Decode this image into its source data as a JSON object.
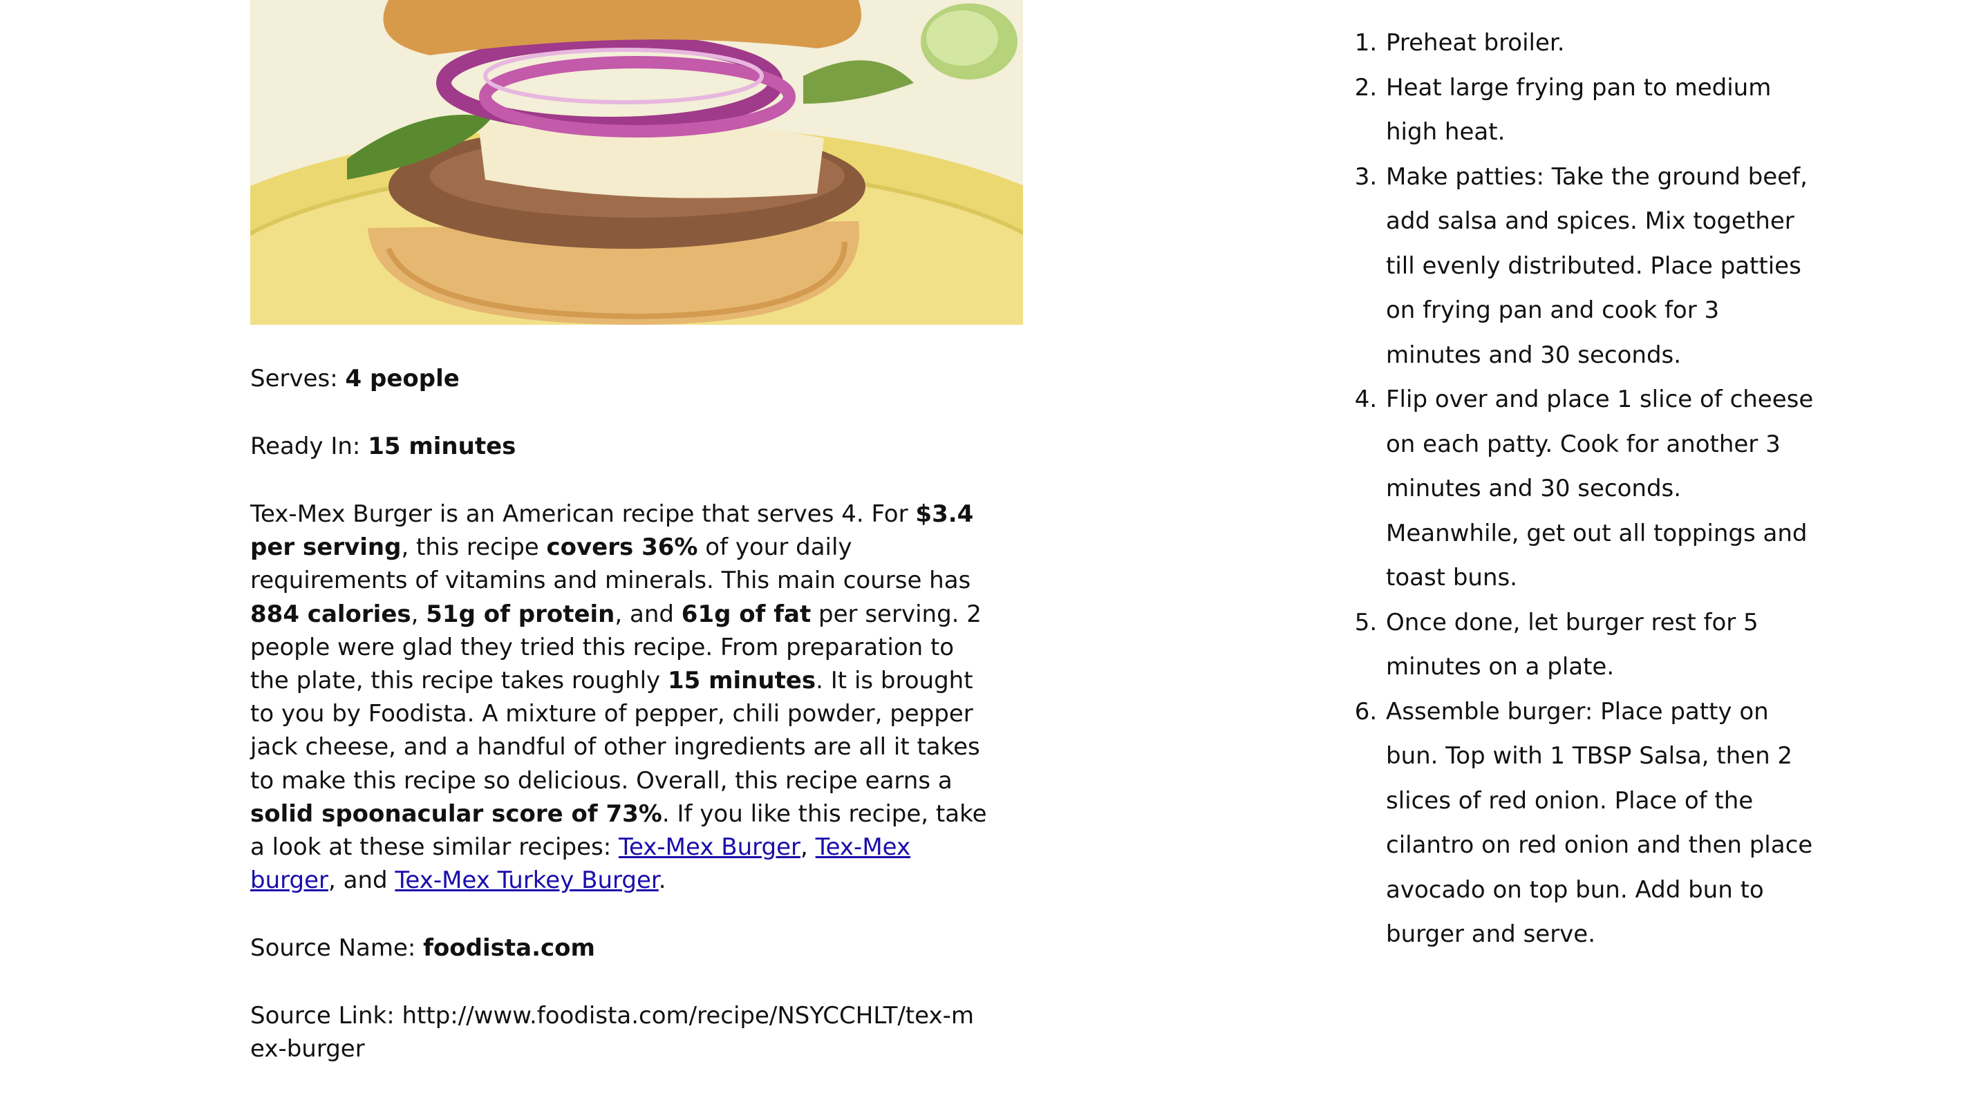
{
  "recipe": {
    "serves_label": "Serves: ",
    "serves_value": "4 people",
    "ready_label": "Ready In: ",
    "ready_value": "15 minutes",
    "summary": {
      "t1": "Tex-Mex Burger is an American recipe that serves 4. For ",
      "b1": "$3.4 per serving",
      "t2": ", this recipe ",
      "b2": "covers 36%",
      "t3": " of your daily requirements of vitamins and minerals. This main course has ",
      "b3": "884 calories",
      "t4": ", ",
      "b4": "51g of protein",
      "t5": ", and ",
      "b5": "61g of fat",
      "t6": " per serving. 2 people were glad they tried this recipe. From preparation to the plate, this recipe takes roughly ",
      "b6": "15 minutes",
      "t7": ". It is brought to you by Foodista. A mixture of pepper, chili powder, pepper jack cheese, and a handful of other ingredients are all it takes to make this recipe so delicious. Overall, this recipe earns a ",
      "b7": "solid spoonacular score of 73%",
      "t8": ". If you like this recipe, take a look at these similar recipes: ",
      "link1": "Tex-Mex Burger",
      "t9": ", ",
      "link2": "Tex-Mex burger",
      "t10": ", and ",
      "link3": "Tex-Mex Turkey Burger",
      "t11": "."
    },
    "source_name_label": "Source Name: ",
    "source_name_value": "foodista.com",
    "source_link_label": "Source Link: ",
    "source_link_value": "http://www.foodista.com/recipe/NSYCCHLT/tex-mex-burger"
  },
  "instructions": [
    "Preheat broiler.",
    "Heat large frying pan to medium high heat.",
    "Make patties: Take the ground beef, add salsa and spices. Mix together till evenly distributed. Place patties on frying pan and cook for 3 minutes and 30 seconds.",
    "Flip over and place 1 slice of cheese on each patty. Cook for another 3 minutes and 30 seconds. Meanwhile, get out all toppings and toast buns.",
    "Once done, let burger rest for 5 minutes on a plate.",
    "Assemble burger: Place patty on bun. Top with 1 TBSP Salsa, then 2 slices of red onion. Place of the cilantro on red onion and then place avocado on top bun. Add bun to burger and serve."
  ],
  "colors": {
    "link": "#1a0dab",
    "text": "#111111",
    "plate": "#ecd870"
  }
}
